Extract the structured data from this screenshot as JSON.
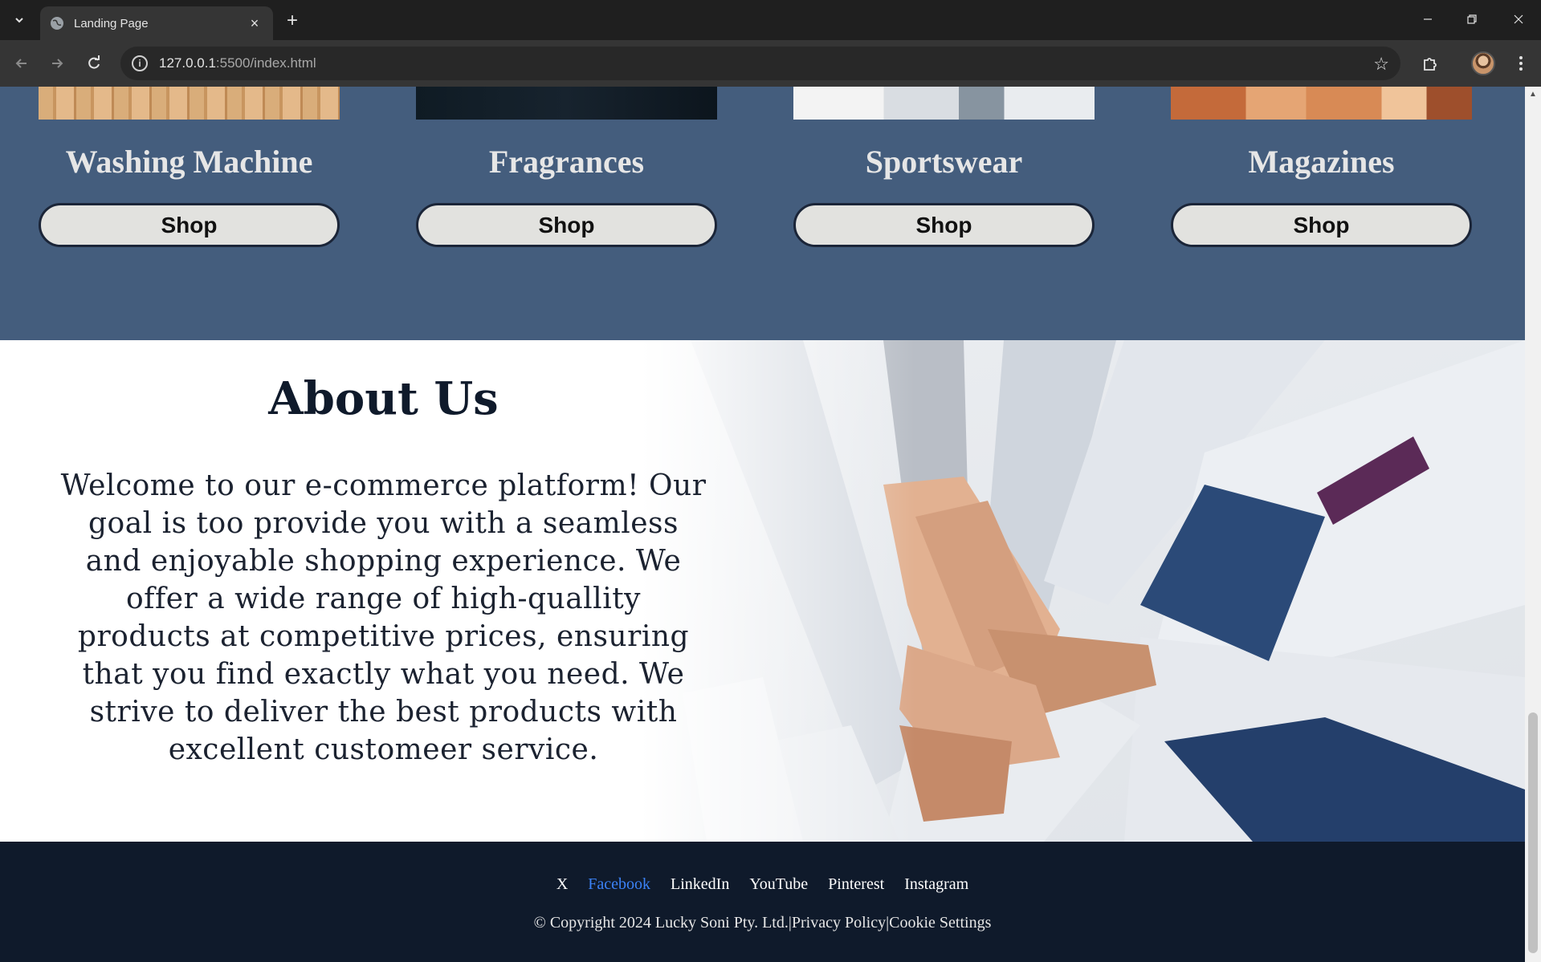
{
  "browser": {
    "tab_title": "Landing Page",
    "url_host": "127.0.0.1",
    "url_rest": ":5500/index.html",
    "icons": {
      "tab_dropdown": "chevron-down-icon",
      "favicon": "globe-icon",
      "close": "close-icon",
      "new_tab": "plus-icon",
      "back": "arrow-left-icon",
      "forward": "arrow-right-icon",
      "reload": "reload-icon",
      "site_info": "info-icon",
      "bookmark": "star-icon",
      "extensions": "puzzle-icon",
      "menu": "kebab-menu-icon"
    }
  },
  "categories": [
    {
      "title": "Washing Machine",
      "button": "Shop"
    },
    {
      "title": "Fragrances",
      "button": "Shop"
    },
    {
      "title": "Sportswear",
      "button": "Shop"
    },
    {
      "title": "Magazines",
      "button": "Shop"
    }
  ],
  "about": {
    "title": "About Us",
    "text": "Welcome to our e-commerce platform! Our goal is too provide you with a seamless and enjoyable shopping experience. We offer a wide range of high-quallity products at competitive prices, ensuring that you find exactly what you need. We strive to deliver the best products with excellent customeer service."
  },
  "footer": {
    "social": [
      "X",
      "Facebook",
      "LinkedIn",
      "YouTube",
      "Pinterest",
      "Instagram"
    ],
    "copyright": "© Copyright 2024 Lucky Soni Pty. Ltd.",
    "privacy": "Privacy Policy",
    "cookies": "Cookie Settings",
    "separator": "|"
  },
  "colors": {
    "category_bg": "#445d7d",
    "footer_bg": "#0f1a2b",
    "link_active": "#3b82f6"
  }
}
